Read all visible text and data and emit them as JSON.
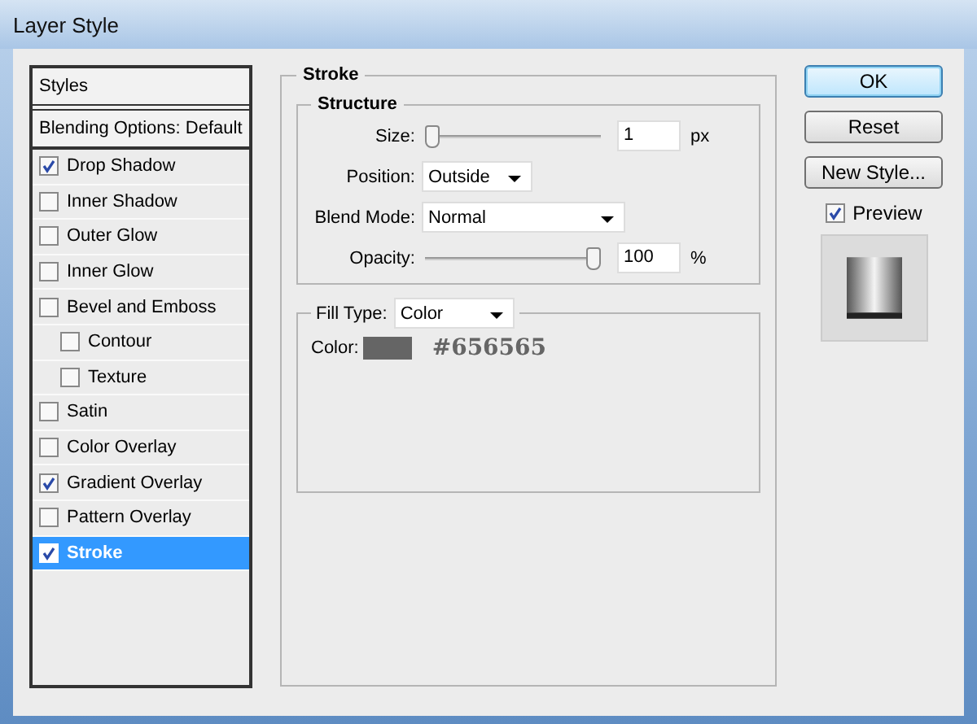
{
  "window": {
    "title": "Layer Style"
  },
  "styles_panel": {
    "header": "Styles",
    "blending": "Blending Options: Default",
    "items": [
      {
        "label": "Drop Shadow",
        "checked": true,
        "selected": false
      },
      {
        "label": "Inner Shadow",
        "checked": false,
        "selected": false
      },
      {
        "label": "Outer Glow",
        "checked": false,
        "selected": false
      },
      {
        "label": "Inner Glow",
        "checked": false,
        "selected": false
      },
      {
        "label": "Bevel and Emboss",
        "checked": false,
        "selected": false,
        "children": [
          {
            "label": "Contour",
            "checked": false,
            "selected": false
          },
          {
            "label": "Texture",
            "checked": false,
            "selected": false
          }
        ]
      },
      {
        "label": "Satin",
        "checked": false,
        "selected": false
      },
      {
        "label": "Color Overlay",
        "checked": false,
        "selected": false
      },
      {
        "label": "Gradient Overlay",
        "checked": true,
        "selected": false
      },
      {
        "label": "Pattern Overlay",
        "checked": false,
        "selected": false
      },
      {
        "label": "Stroke",
        "checked": true,
        "selected": true
      }
    ]
  },
  "stroke": {
    "title": "Stroke",
    "structure": {
      "title": "Structure",
      "rows": [
        {
          "kind": "slider",
          "label": "Size:",
          "level": 0,
          "value": "1",
          "unit": "px"
        },
        {
          "kind": "dropdown",
          "label": "Position:",
          "value": "Outside",
          "wide": false
        },
        {
          "kind": "dropdown",
          "label": "Blend Mode:",
          "value": "Normal",
          "wide": true
        },
        {
          "kind": "slider",
          "label": "Opacity:",
          "level": 1,
          "value": "100",
          "unit": "%"
        }
      ]
    },
    "fill": {
      "label": "Fill Type:",
      "value": "Color",
      "color_label": "Color:",
      "color": "#656565",
      "hex": "#656565"
    }
  },
  "buttons": [
    {
      "label": "OK",
      "default": true
    },
    {
      "label": "Reset",
      "default": false
    },
    {
      "label": "New Style...",
      "default": false
    }
  ],
  "preview": {
    "label": "Preview",
    "checked": true
  }
}
